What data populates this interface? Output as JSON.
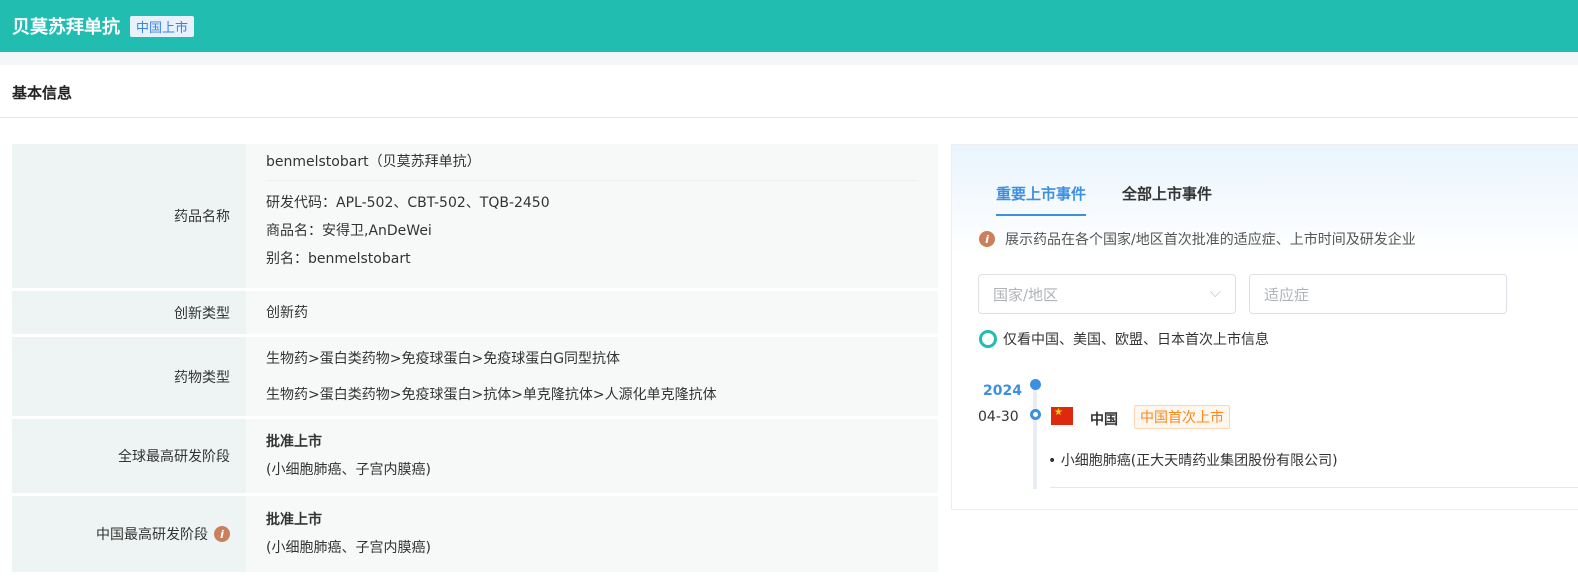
{
  "header": {
    "title": "贝莫苏拜单抗",
    "tag": "中国上市"
  },
  "section_title": "基本信息",
  "rows": [
    {
      "label": "药品名称",
      "values": [
        "benmelstobart（贝莫苏拜单抗）",
        "研发代码：APL-502、CBT-502、TQB-2450",
        "商品名：安得卫,AnDeWei",
        "别名：benmelstobart"
      ]
    },
    {
      "label": "创新类型",
      "values": [
        "创新药"
      ]
    },
    {
      "label": "药物类型",
      "values": [
        "生物药>蛋白类药物>免疫球蛋白>免疫球蛋白G同型抗体",
        "生物药>蛋白类药物>免疫球蛋白>抗体>单克隆抗体>人源化单克隆抗体"
      ]
    },
    {
      "label": "全球最高研发阶段",
      "values": [
        "批准上市",
        "(小细胞肺癌、子宫内膜癌)"
      ]
    },
    {
      "label": "中国最高研发阶段",
      "values": [
        "批准上市",
        "(小细胞肺癌、子宫内膜癌)"
      ]
    }
  ],
  "panel": {
    "tabs": [
      "重要上市事件",
      "全部上市事件"
    ],
    "description": "展示药品在各个国家/地区首次批准的适应症、上市时间及研发企业",
    "country_placeholder": "国家/地区",
    "indication_placeholder": "适应症",
    "toggle_label": "仅看中国、美国、欧盟、日本首次上市信息",
    "event": {
      "year": "2024",
      "date": "04-30",
      "country": "中国",
      "tag": "中国首次上市",
      "indication": "小细胞肺癌(正大天晴药业集团股份有限公司)"
    }
  }
}
